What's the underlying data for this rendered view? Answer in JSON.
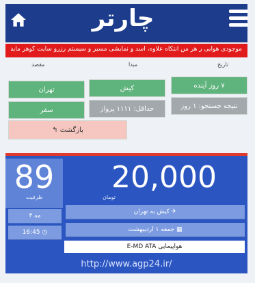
{
  "header": {
    "logo_text": "چارتر"
  },
  "notice": {
    "text": "موجودی هوایی ر هر من انتکاه علاوه، اسد و نمایشی مسیر و سیستم رزرو سایت گوهر مایشی"
  },
  "search": {
    "date_label": "تاریخ",
    "origin_label": "مبدا",
    "destination_label": "مقصد",
    "date_value": "۷ روز آینده",
    "origin_value": "کیش",
    "destination_value": "تهران",
    "duration_value": "نتیجه جستجو: ۱ روز",
    "count_value": "حداقل: ۱۱۱۱ پرواز",
    "extra_value": "سفر",
    "back_label": "بازگشت"
  },
  "flight": {
    "seats": "89",
    "seats_label": "ظرفیت",
    "price": "20,000",
    "price_unit": "تومان",
    "route": "کیش به تهران",
    "date": "جمعه ۱ اردیبهشت",
    "small_1": "۳ مه",
    "time": "16:45",
    "airline_label": "هواپیمایی",
    "airline": "E-MD ATA"
  },
  "footer": {
    "url": "http://www.agp24.ir/"
  }
}
